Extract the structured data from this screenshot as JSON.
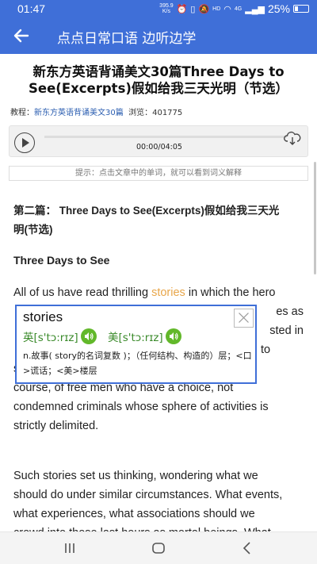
{
  "status": {
    "time": "01:47",
    "net_speed_value": "395.9",
    "net_speed_unit": "K/s",
    "network": "HD",
    "signal": "4G",
    "battery_pct": "25%"
  },
  "appbar": {
    "title": "点点日常口语 边听边学"
  },
  "article": {
    "title": "新东方英语背诵美文30篇Three Days to See(Excerpts)假如给我三天光明（节选）",
    "meta_course_label": "教程：",
    "meta_course": "新东方英语背诵美文30篇",
    "meta_views_label": "浏览：",
    "meta_views": "401775"
  },
  "player": {
    "time": "00:00/04:05",
    "progress": 0
  },
  "tip": "提示：点击文章中的单词，就可以看到词义解释",
  "text": {
    "section_head_1": "第二篇： Three Days to See(Excerpts)假如给我三天光",
    "section_head_2": "明(节选)",
    "subhead": "Three Days to See",
    "p1_l1_a": "All of us have read thrilling ",
    "p1_l1_word": "stories",
    "p1_l1_b": " in which the hero",
    "p1_l2": "had only a limited and specified time to live. Sometimes as",
    "p1_l3": "long as a year, sometimes as short as 24 hours, interested in",
    "p1_l4": "discovering just how the doomed hero chose to",
    "p1_l5": "spend his last days or his last hours. I speak, of",
    "p1_l6": "course, of free men who have a choice, not",
    "p1_l7": "condemned criminals whose sphere of activities is",
    "p1_l8": "strictly delimited.",
    "p1_frag_2": "es as",
    "p1_frag_3": "sted in",
    "p1_frag_4": "to",
    "p2_l1": "Such stories set us thinking, wondering what we",
    "p2_l2": "should do under similar circumstances. What events,",
    "p2_l3": "what experiences, what associations should we",
    "p2_l4": "crowd into those last hours as mortal beings. What"
  },
  "popup": {
    "word": "stories",
    "uk_label": "英[s'tɔ:rɪz]",
    "us_label": "美[s'tɔ:rɪz]",
    "definition": "n.故事( story的名词复数 )；（任何结构、构造的）层；<口>谎话；<美>楼层"
  },
  "colors": {
    "primary": "#3f6fd8",
    "highlight": "#e8a64a",
    "phonetic": "#3a8a2a",
    "speaker": "#62b82a"
  }
}
